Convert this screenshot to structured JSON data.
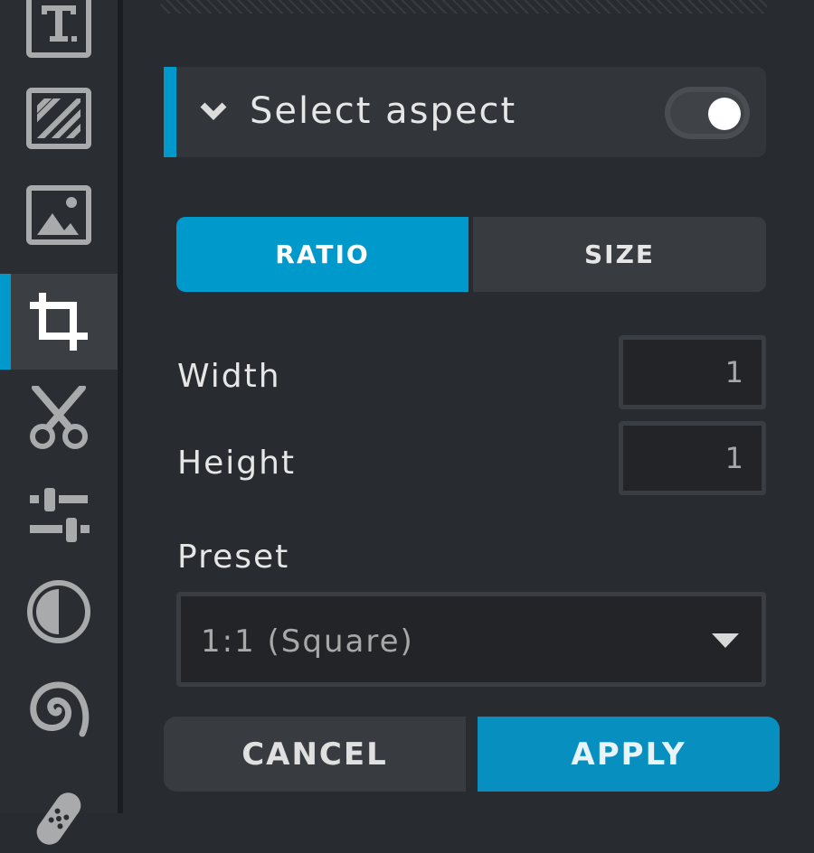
{
  "sidebar": {
    "items": [
      {
        "id": "text",
        "icon": "text-icon",
        "active": false
      },
      {
        "id": "texture",
        "icon": "texture-icon",
        "active": false
      },
      {
        "id": "image",
        "icon": "image-icon",
        "active": false
      },
      {
        "id": "crop",
        "icon": "crop-icon",
        "active": true
      },
      {
        "id": "cut",
        "icon": "scissors-icon",
        "active": false
      },
      {
        "id": "adjust",
        "icon": "sliders-icon",
        "active": false
      },
      {
        "id": "contrast",
        "icon": "contrast-icon",
        "active": false
      },
      {
        "id": "swirl",
        "icon": "swirl-icon",
        "active": false
      },
      {
        "id": "heal",
        "icon": "bandage-icon",
        "active": false
      }
    ],
    "accent": "#0099cc"
  },
  "panel": {
    "header": {
      "title": "Select aspect",
      "toggle_on": true
    },
    "tabs": [
      {
        "label": "RATIO",
        "active": true
      },
      {
        "label": "SIZE",
        "active": false
      }
    ],
    "fields": {
      "width_label": "Width",
      "width_value": "1",
      "height_label": "Height",
      "height_value": "1"
    },
    "preset": {
      "label": "Preset",
      "selected": "1:1 (Square)"
    },
    "actions": {
      "cancel_label": "CANCEL",
      "apply_label": "APPLY"
    }
  }
}
